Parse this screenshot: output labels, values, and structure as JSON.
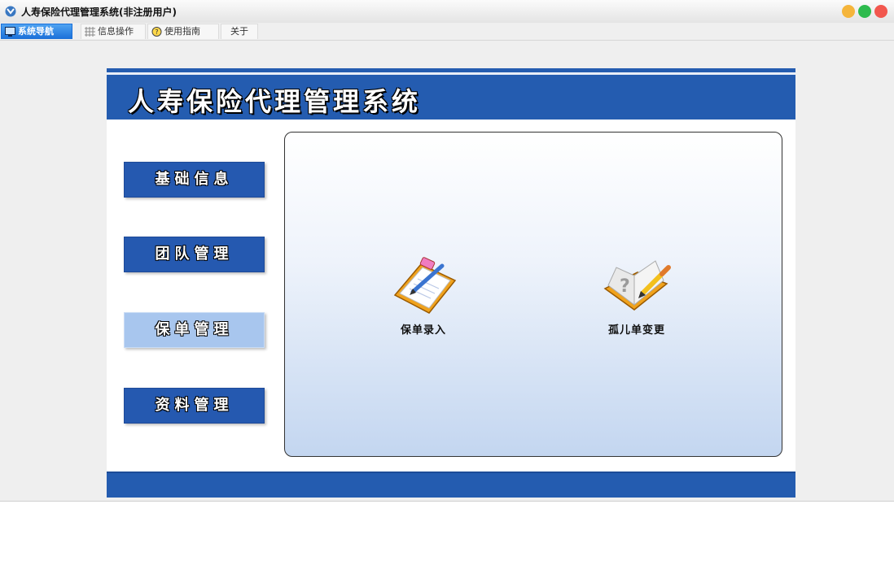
{
  "window": {
    "title": "人寿保险代理管理系统(非注册用户)",
    "controls": [
      "minimize",
      "maximize",
      "close"
    ]
  },
  "tabs": [
    {
      "label": "系统导航",
      "icon": "monitor-icon",
      "active": true
    },
    {
      "label": "信息操作",
      "icon": "grid-icon",
      "active": false
    },
    {
      "label": "使用指南",
      "icon": "help-icon",
      "active": false
    },
    {
      "label": "关于",
      "icon": "",
      "active": false
    }
  ],
  "panel": {
    "title": "人寿保险代理管理系统"
  },
  "nav": [
    {
      "label": "基础信息",
      "active": false
    },
    {
      "label": "团队管理",
      "active": false
    },
    {
      "label": "保单管理",
      "active": true
    },
    {
      "label": "资料管理",
      "active": false
    }
  ],
  "functions": [
    {
      "label": "保单录入",
      "icon": "clipboard-pencil-icon"
    },
    {
      "label": "孤儿单变更",
      "icon": "book-pencil-icon"
    }
  ],
  "colors": {
    "primary": "#245cb0",
    "active_nav": "#a8c6ee",
    "tab_active": "#1a6fd8"
  }
}
